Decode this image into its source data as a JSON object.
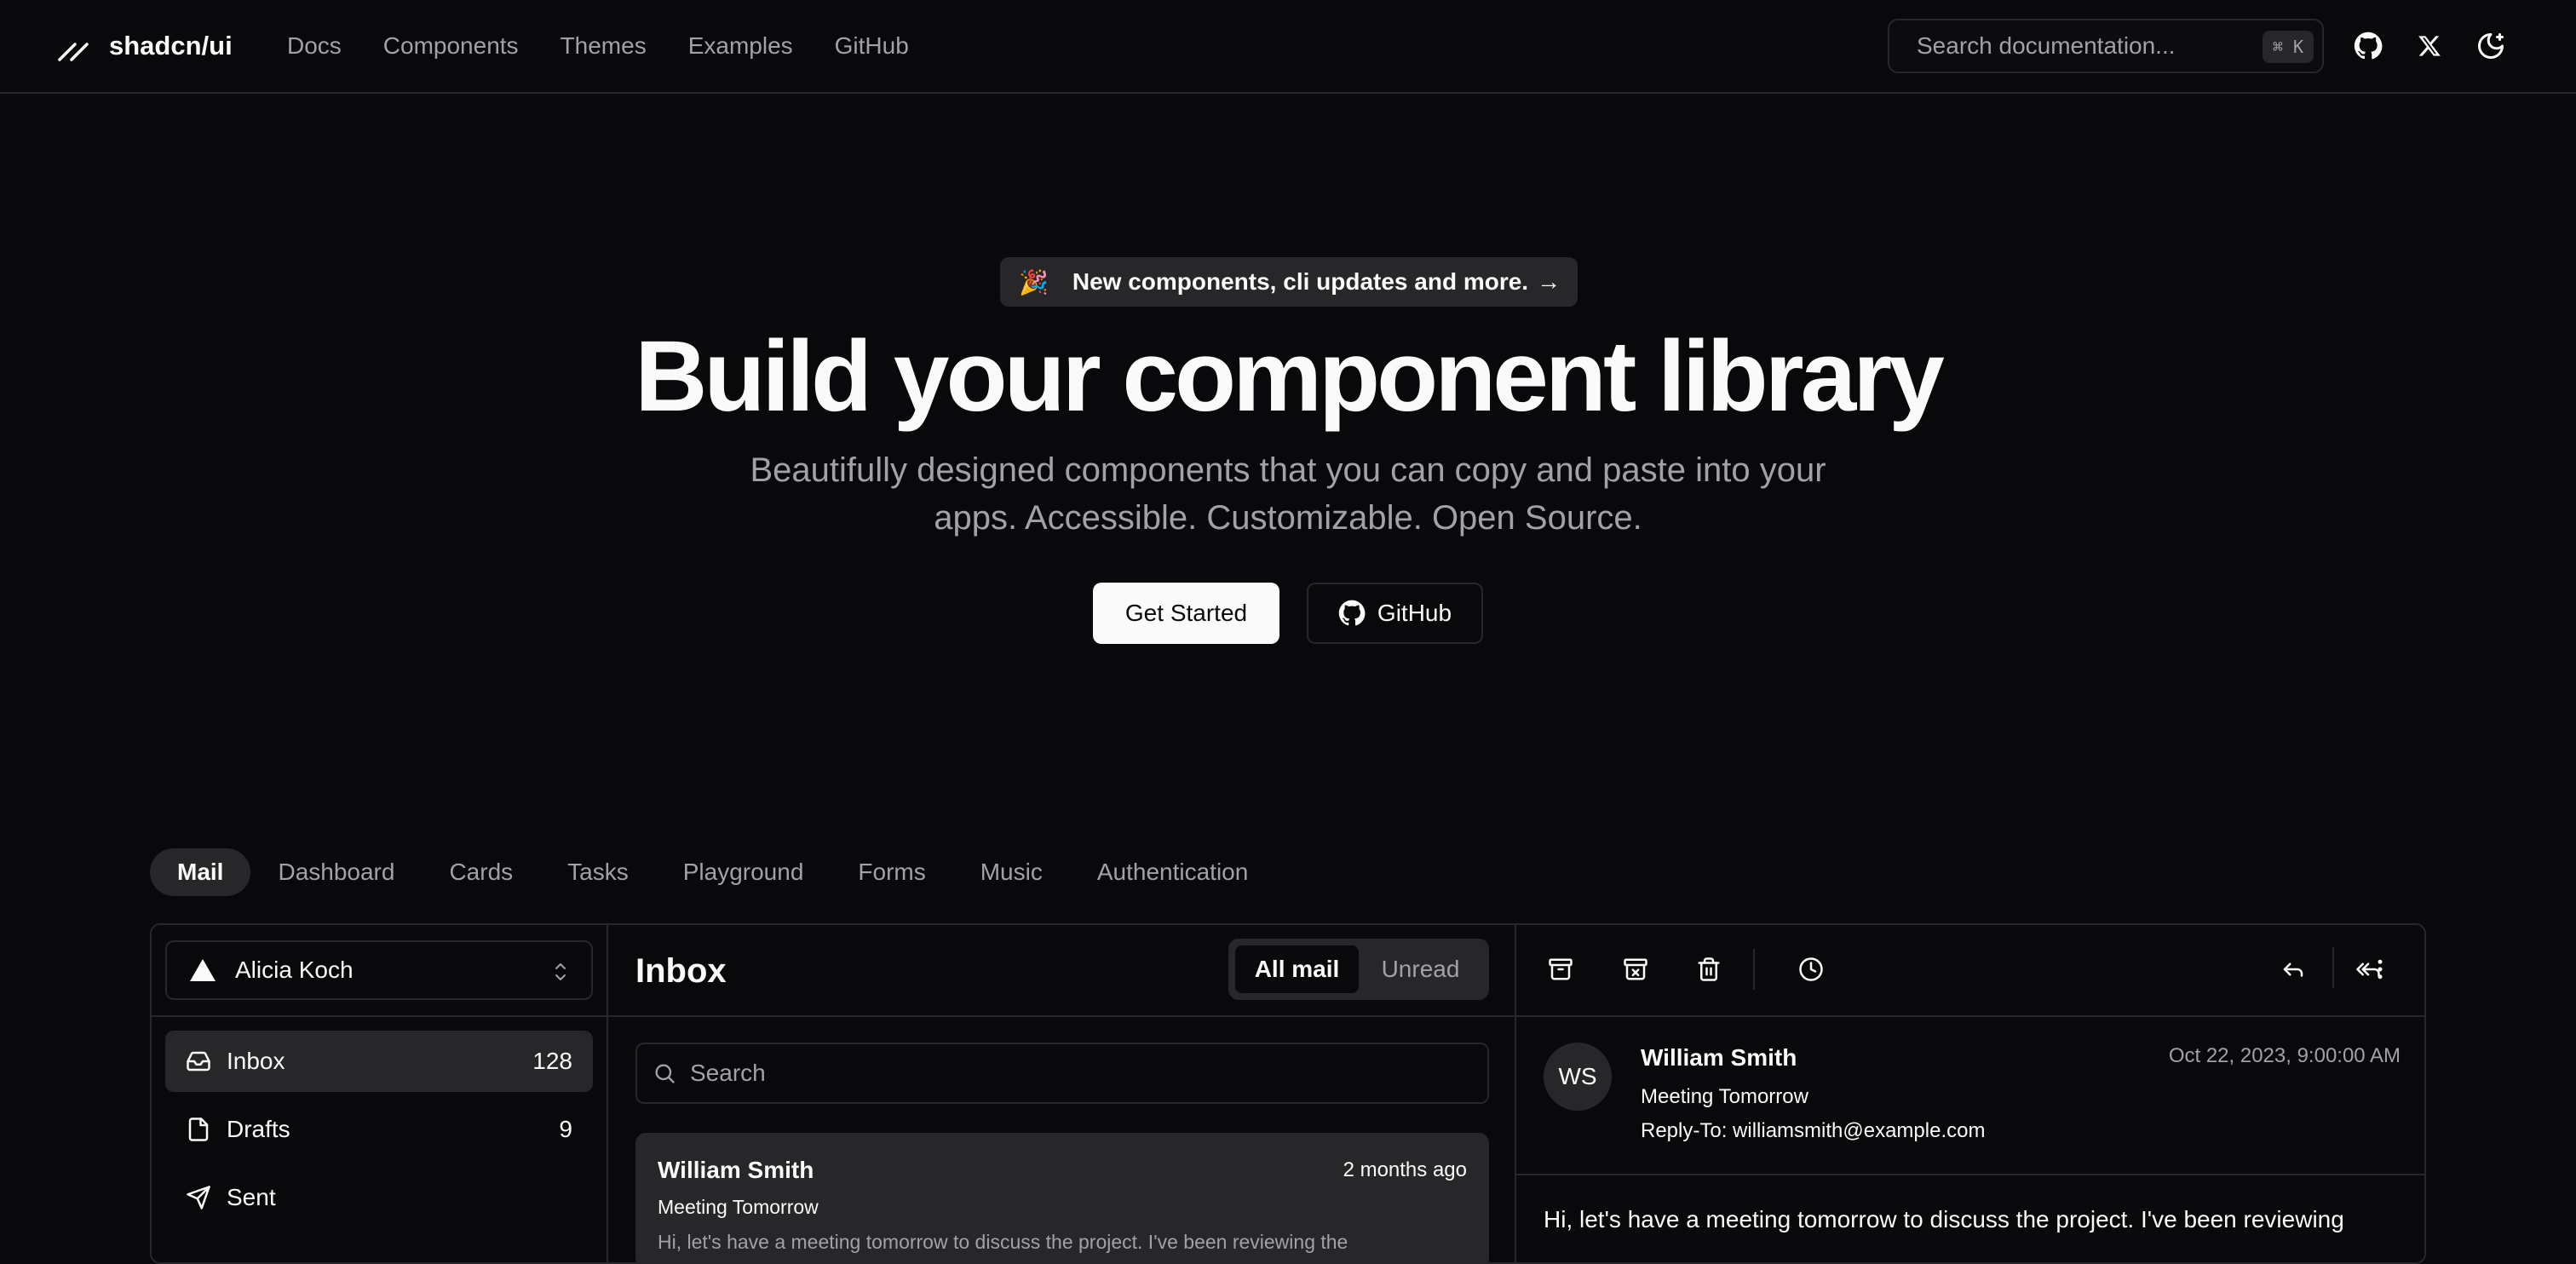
{
  "header": {
    "brand": "shadcn/ui",
    "nav": [
      "Docs",
      "Components",
      "Themes",
      "Examples",
      "GitHub"
    ],
    "search_placeholder": "Search documentation...",
    "search_shortcut": "⌘ K",
    "icons": [
      "github-icon",
      "x-icon",
      "theme-toggle-icon"
    ]
  },
  "hero": {
    "announcement_emoji": "🎉",
    "announcement": "New components, cli updates and more.",
    "announcement_arrow": "→",
    "title": "Build your component library",
    "subtitle": "Beautifully designed components that you can copy and paste into your apps. Accessible. Customizable. Open Source.",
    "primary_button": "Get Started",
    "secondary_button": "GitHub"
  },
  "demo_tabs": [
    "Mail",
    "Dashboard",
    "Cards",
    "Tasks",
    "Playground",
    "Forms",
    "Music",
    "Authentication"
  ],
  "mail": {
    "account": "Alicia Koch",
    "folders": [
      {
        "label": "Inbox",
        "count": "128"
      },
      {
        "label": "Drafts",
        "count": "9"
      },
      {
        "label": "Sent",
        "count": ""
      }
    ],
    "list_title": "Inbox",
    "filters": [
      "All mail",
      "Unread"
    ],
    "search_placeholder": "Search",
    "items": [
      {
        "from": "William Smith",
        "date": "2 months ago",
        "subject": "Meeting Tomorrow",
        "preview": "Hi, let's have a meeting tomorrow to discuss the project. I've been reviewing the"
      }
    ],
    "reader": {
      "initials": "WS",
      "from": "William Smith",
      "subject": "Meeting Tomorrow",
      "reply_to": "Reply-To: williamsmith@example.com",
      "date": "Oct 22, 2023, 9:00:00 AM",
      "body": "Hi, let's have a meeting tomorrow to discuss the project. I've been reviewing"
    }
  }
}
